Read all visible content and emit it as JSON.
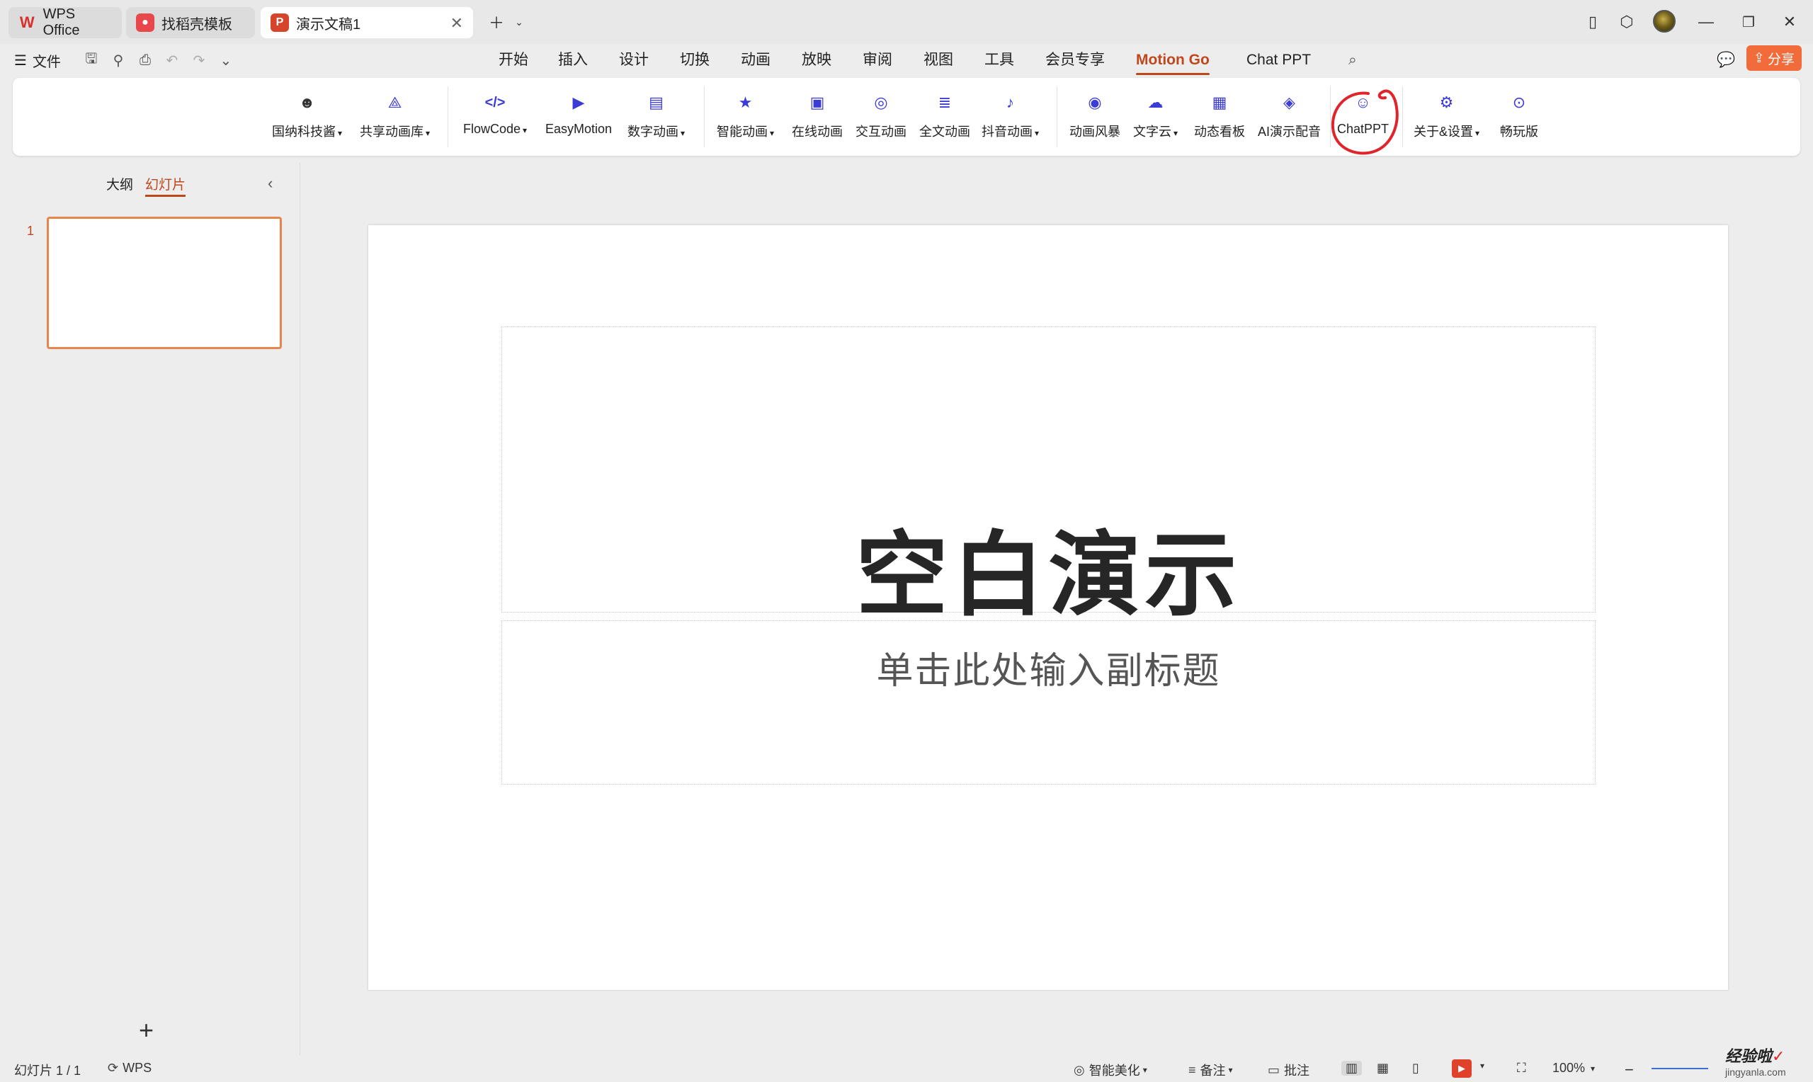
{
  "tabs": [
    {
      "label": "WPS Office"
    },
    {
      "label": "找稻壳模板"
    },
    {
      "label": "演示文稿1"
    }
  ],
  "menu": {
    "file": "文件",
    "items": [
      "开始",
      "插入",
      "设计",
      "切换",
      "动画",
      "放映",
      "审阅",
      "视图",
      "工具",
      "会员专享",
      "Motion Go",
      "Chat PPT"
    ],
    "active": "Motion Go",
    "share": "分享"
  },
  "ribbon": {
    "groups": [
      {
        "label": "国纳科技酱",
        "dropdown": true
      },
      {
        "label": "共享动画库",
        "dropdown": true
      },
      {
        "label": "FlowCode",
        "dropdown": true
      },
      {
        "label": "EasyMotion",
        "dropdown": false
      },
      {
        "label": "数字动画",
        "dropdown": true
      },
      {
        "label": "智能动画",
        "dropdown": true
      },
      {
        "label": "在线动画",
        "dropdown": false
      },
      {
        "label": "交互动画",
        "dropdown": false
      },
      {
        "label": "全文动画",
        "dropdown": false
      },
      {
        "label": "抖音动画",
        "dropdown": true
      },
      {
        "label": "动画风暴",
        "dropdown": false
      },
      {
        "label": "文字云",
        "dropdown": true
      },
      {
        "label": "动态看板",
        "dropdown": false
      },
      {
        "label": "AI演示配音",
        "dropdown": false
      },
      {
        "label": "ChatPPT",
        "dropdown": false
      },
      {
        "label": "关于&设置",
        "dropdown": true
      },
      {
        "label": "畅玩版",
        "dropdown": false
      }
    ]
  },
  "left_panel": {
    "tab_outline": "大纲",
    "tab_slides": "幻灯片",
    "slide_number": "1"
  },
  "slide": {
    "title": "空白演示",
    "subtitle": "单击此处输入副标题"
  },
  "status": {
    "slide_count": "幻灯片 1 / 1",
    "app": "WPS",
    "beautify": "智能美化",
    "notes": "备注",
    "comments": "批注",
    "zoom": "100%"
  },
  "watermark": {
    "text": "经验啦",
    "url": "jingyanla.com"
  },
  "colors": {
    "accent": "#c0461c",
    "share": "#f26b3a",
    "ribbon_icon": "#3b3bd6",
    "highlight_circle": "#e0242b"
  }
}
